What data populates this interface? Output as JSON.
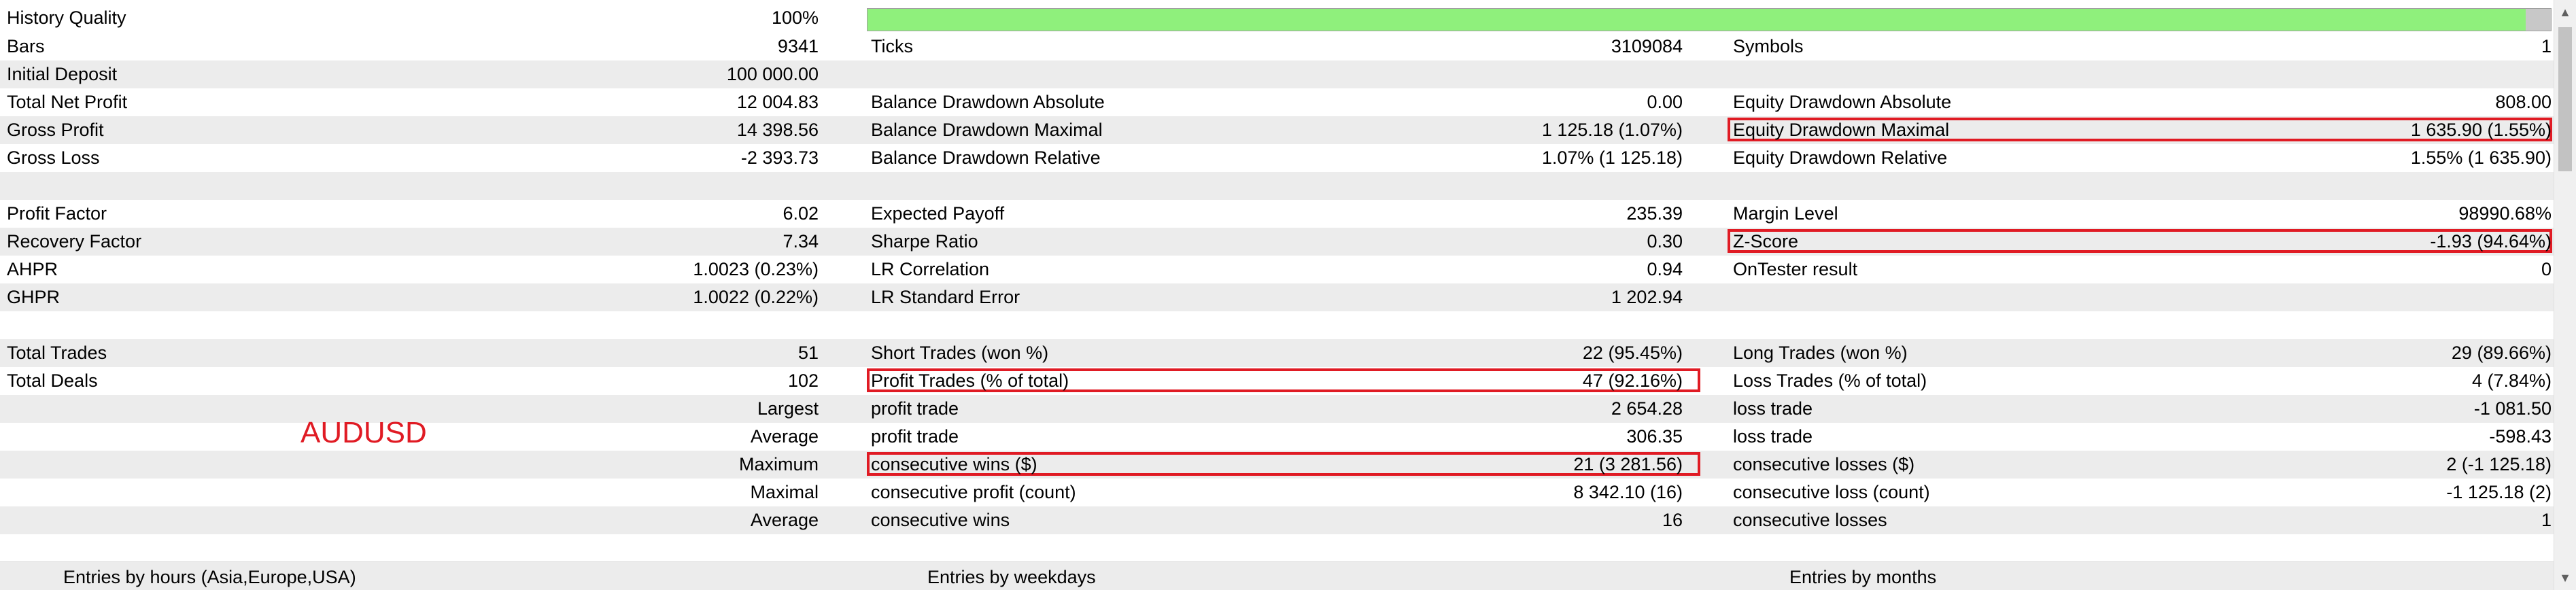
{
  "history_quality": {
    "label": "History Quality",
    "value": "100%",
    "fraction": 0.985
  },
  "rows": [
    {
      "shade": false,
      "c1": [
        "Bars",
        "9341"
      ],
      "c2": [
        "Ticks",
        "3109084"
      ],
      "c3": [
        "Symbols",
        "1"
      ]
    },
    {
      "shade": true,
      "c1": [
        "Initial Deposit",
        "100 000.00"
      ],
      "c2": [
        "",
        ""
      ],
      "c3": [
        "",
        ""
      ]
    },
    {
      "shade": false,
      "c1": [
        "Total Net Profit",
        "12 004.83"
      ],
      "c2": [
        "Balance Drawdown Absolute",
        "0.00"
      ],
      "c3": [
        "Equity Drawdown Absolute",
        "808.00"
      ]
    },
    {
      "shade": true,
      "c1": [
        "Gross Profit",
        "14 398.56"
      ],
      "c2": [
        "Balance Drawdown Maximal",
        "1 125.18 (1.07%)"
      ],
      "c3": [
        "Equity Drawdown Maximal",
        "1 635.90 (1.55%)"
      ]
    },
    {
      "shade": false,
      "c1": [
        "Gross Loss",
        "-2 393.73"
      ],
      "c2": [
        "Balance Drawdown Relative",
        "1.07% (1 125.18)"
      ],
      "c3": [
        "Equity Drawdown Relative",
        "1.55% (1 635.90)"
      ]
    },
    {
      "shade": true,
      "c1": [
        "",
        ""
      ],
      "c2": [
        "",
        ""
      ],
      "c3": [
        "",
        ""
      ]
    },
    {
      "shade": false,
      "c1": [
        "Profit Factor",
        "6.02"
      ],
      "c2": [
        "Expected Payoff",
        "235.39"
      ],
      "c3": [
        "Margin Level",
        "98990.68%"
      ]
    },
    {
      "shade": true,
      "c1": [
        "Recovery Factor",
        "7.34"
      ],
      "c2": [
        "Sharpe Ratio",
        "0.30"
      ],
      "c3": [
        "Z-Score",
        "-1.93 (94.64%)"
      ]
    },
    {
      "shade": false,
      "c1": [
        "AHPR",
        "1.0023 (0.23%)"
      ],
      "c2": [
        "LR Correlation",
        "0.94"
      ],
      "c3": [
        "OnTester result",
        "0"
      ]
    },
    {
      "shade": true,
      "c1": [
        "GHPR",
        "1.0022 (0.22%)"
      ],
      "c2": [
        "LR Standard Error",
        "1 202.94"
      ],
      "c3": [
        "",
        ""
      ]
    },
    {
      "shade": false,
      "c1": [
        "",
        ""
      ],
      "c2": [
        "",
        ""
      ],
      "c3": [
        "",
        ""
      ]
    },
    {
      "shade": true,
      "c1": [
        "Total Trades",
        "51"
      ],
      "c2": [
        "Short Trades (won %)",
        "22 (95.45%)"
      ],
      "c3": [
        "Long Trades (won %)",
        "29 (89.66%)"
      ]
    },
    {
      "shade": false,
      "c1": [
        "Total Deals",
        "102"
      ],
      "c2": [
        "Profit Trades (% of total)",
        "47 (92.16%)"
      ],
      "c3": [
        "Loss Trades (% of total)",
        "4 (7.84%)"
      ]
    },
    {
      "shade": true,
      "c1": [
        "",
        "Largest"
      ],
      "c2": [
        "profit trade",
        "2 654.28"
      ],
      "c3": [
        "loss trade",
        "-1 081.50"
      ]
    },
    {
      "shade": false,
      "c1": [
        "",
        "Average"
      ],
      "c2": [
        "profit trade",
        "306.35"
      ],
      "c3": [
        "loss trade",
        "-598.43"
      ]
    },
    {
      "shade": true,
      "c1": [
        "",
        "Maximum"
      ],
      "c2": [
        "consecutive wins ($)",
        "21 (3 281.56)"
      ],
      "c3": [
        "consecutive losses ($)",
        "2 (-1 125.18)"
      ]
    },
    {
      "shade": false,
      "c1": [
        "",
        "Maximal"
      ],
      "c2": [
        "consecutive profit (count)",
        "8 342.10 (16)"
      ],
      "c3": [
        "consecutive loss (count)",
        "-1 125.18 (2)"
      ]
    },
    {
      "shade": true,
      "c1": [
        "",
        "Average"
      ],
      "c2": [
        "consecutive wins",
        "16"
      ],
      "c3": [
        "consecutive losses",
        "1"
      ]
    },
    {
      "shade": false,
      "c1": [
        "",
        ""
      ],
      "c2": [
        "",
        ""
      ],
      "c3": [
        "",
        ""
      ]
    },
    {
      "shade": true,
      "c1": [
        "",
        ""
      ],
      "c2": [
        "",
        ""
      ],
      "c3": [
        "",
        ""
      ]
    }
  ],
  "annotation": "AUDUSD",
  "highlight_color": "#e01b24",
  "progress_color": "#8ff07c",
  "bottom_sections": [
    "Entries by hours (Asia,Europe,USA)",
    "Entries by weekdays",
    "Entries by months"
  ],
  "scrollbar": {
    "up_icon": "chevron-up-icon",
    "down_icon": "chevron-down-icon"
  }
}
